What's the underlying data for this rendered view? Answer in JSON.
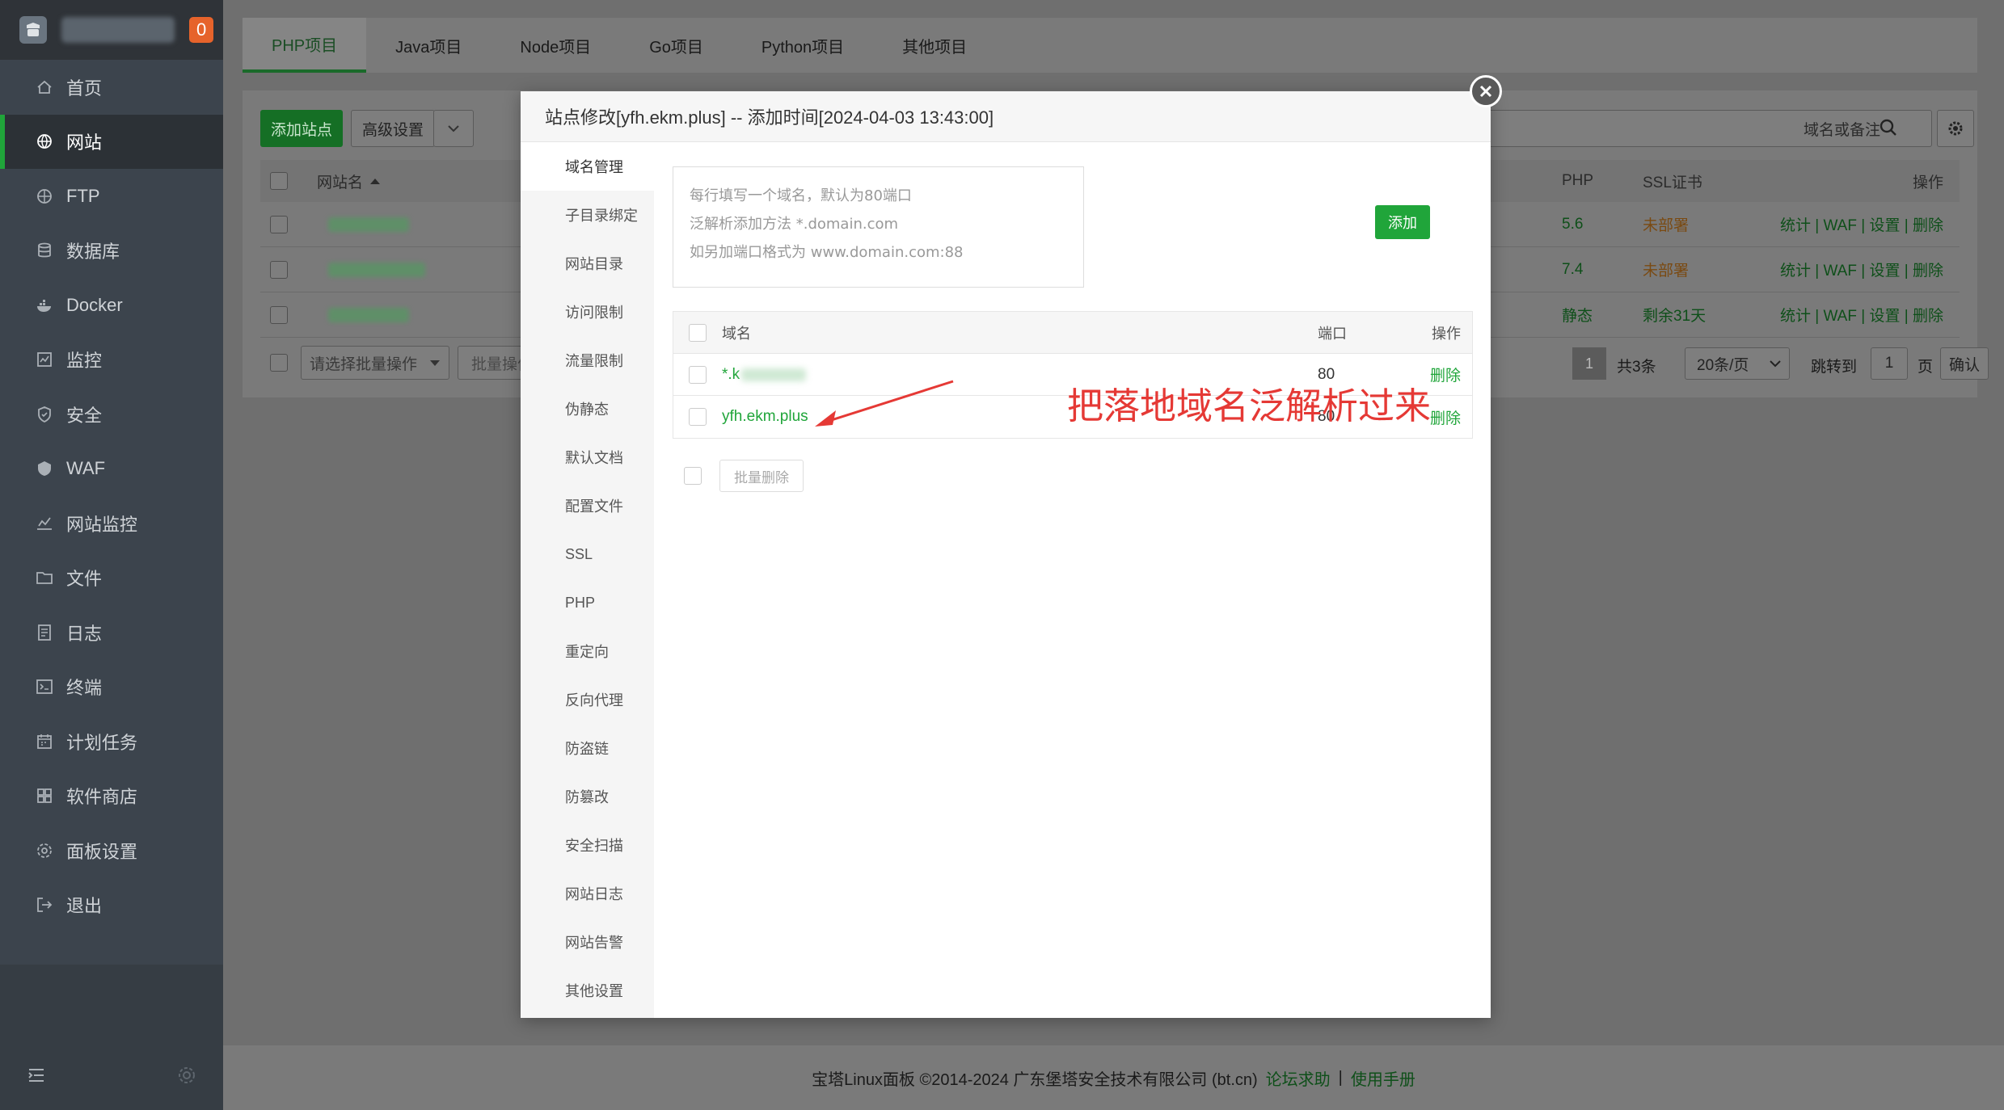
{
  "sidebar": {
    "badge": "0",
    "items": [
      {
        "label": "首页",
        "icon": "home-icon"
      },
      {
        "label": "网站",
        "icon": "globe-icon",
        "active": true
      },
      {
        "label": "FTP",
        "icon": "ftp-icon"
      },
      {
        "label": "数据库",
        "icon": "database-icon"
      },
      {
        "label": "Docker",
        "icon": "docker-icon"
      },
      {
        "label": "监控",
        "icon": "monitor-icon"
      },
      {
        "label": "安全",
        "icon": "shield-icon"
      },
      {
        "label": "WAF",
        "icon": "waf-icon"
      },
      {
        "label": "网站监控",
        "icon": "site-monitor-icon"
      },
      {
        "label": "文件",
        "icon": "folder-icon"
      },
      {
        "label": "日志",
        "icon": "log-icon"
      },
      {
        "label": "终端",
        "icon": "terminal-icon"
      },
      {
        "label": "计划任务",
        "icon": "calendar-icon"
      },
      {
        "label": "软件商店",
        "icon": "app-store-icon"
      },
      {
        "label": "面板设置",
        "icon": "settings-icon"
      },
      {
        "label": "退出",
        "icon": "logout-icon"
      }
    ]
  },
  "tabs": [
    "PHP项目",
    "Java项目",
    "Node项目",
    "Go项目",
    "Python项目",
    "其他项目"
  ],
  "toolbar": {
    "add_site": "添加站点",
    "advanced": "高级设置",
    "search_placeholder": "域名或备注"
  },
  "bg_table": {
    "col_site": "网站名",
    "col_php": "PHP",
    "col_ssl": "SSL证书",
    "col_op": "操作",
    "rows": [
      {
        "php": "5.6",
        "ssl": "未部署"
      },
      {
        "php": "7.4",
        "ssl": "未部署"
      },
      {
        "php": "静态",
        "ssl": "剩余31天"
      }
    ],
    "actions": [
      "统计",
      "WAF",
      "设置",
      "删除"
    ],
    "batch_placeholder": "请选择批量操作",
    "batch_btn": "批量操作"
  },
  "pagination": {
    "current": "1",
    "total": "共3条",
    "per_page": "20条/页",
    "jump_to": "跳转到",
    "jump_val": "1",
    "page_unit": "页",
    "confirm": "确认"
  },
  "footer": {
    "copyright": "宝塔Linux面板 ©2014-2024 广东堡塔安全技术有限公司 (bt.cn)",
    "forum": "论坛求助",
    "manual": "使用手册"
  },
  "modal": {
    "title": "站点修改[yfh.ekm.plus] -- 添加时间[2024-04-03 13:43:00]",
    "nav": [
      "域名管理",
      "子目录绑定",
      "网站目录",
      "访问限制",
      "流量限制",
      "伪静态",
      "默认文档",
      "配置文件",
      "SSL",
      "PHP",
      "重定向",
      "反向代理",
      "防盗链",
      "防篡改",
      "安全扫描",
      "网站日志",
      "网站告警",
      "其他设置"
    ],
    "textarea_lines": [
      "每行填写一个域名，默认为80端口",
      "泛解析添加方法 *.domain.com",
      "如另加端口格式为 www.domain.com:88"
    ],
    "add_btn": "添加",
    "table": {
      "col_domain": "域名",
      "col_port": "端口",
      "col_op": "操作",
      "rows": [
        {
          "domain": "*.k",
          "port": "80",
          "op": "删除"
        },
        {
          "domain": "yfh.ekm.plus",
          "port": "80",
          "op": "删除"
        }
      ]
    },
    "batch_delete": "批量删除",
    "annotation": "把落地域名泛解析过来"
  }
}
